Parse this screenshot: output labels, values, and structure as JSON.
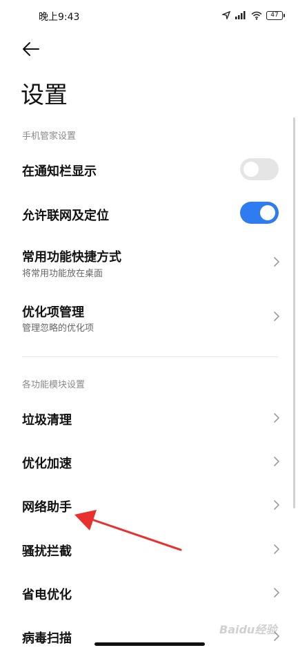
{
  "status_bar": {
    "time": "晚上9:43",
    "battery": "47"
  },
  "header": {
    "title": "设置"
  },
  "sections": {
    "phone_manager": "手机管家设置",
    "modules": "各功能模块设置"
  },
  "rows": {
    "notify": {
      "label": "在通知栏显示",
      "on": false
    },
    "network_location": {
      "label": "允许联网及定位",
      "on": true
    },
    "shortcut": {
      "label": "常用功能快捷方式",
      "sub": "将常用功能放在桌面"
    },
    "optimize_items": {
      "label": "优化项管理",
      "sub": "管理忽略的优化项"
    },
    "cleanup": {
      "label": "垃圾清理"
    },
    "speedup": {
      "label": "优化加速"
    },
    "network_assistant": {
      "label": "网络助手"
    },
    "block": {
      "label": "骚扰拦截"
    },
    "power": {
      "label": "省电优化"
    },
    "virus": {
      "label": "病毒扫描"
    }
  },
  "watermark": "Baidu经验",
  "colors": {
    "accent": "#2f7bf0",
    "toggle_off": "#e5e5e5",
    "annotation": "#e8302f"
  }
}
